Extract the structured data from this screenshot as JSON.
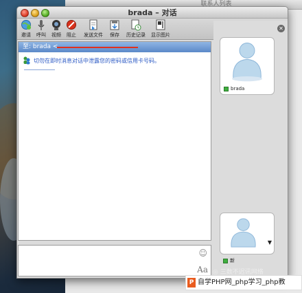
{
  "background_window": {
    "title": "联系人列表"
  },
  "window": {
    "title": "brada – 对话"
  },
  "toolbar": {
    "items": [
      {
        "label": "邀请",
        "icon": "invite-globe-icon"
      },
      {
        "label": "呼叫",
        "icon": "microphone-icon"
      },
      {
        "label": "视频",
        "icon": "webcam-icon"
      },
      {
        "label": "阻止",
        "icon": "block-icon"
      },
      {
        "label": "发送文件",
        "icon": "send-file-icon"
      },
      {
        "label": "保存",
        "icon": "save-icon"
      },
      {
        "label": "历史记录",
        "icon": "history-icon"
      },
      {
        "label": "显示图片",
        "icon": "show-picture-icon"
      }
    ]
  },
  "chat": {
    "header": "至: brada <",
    "warning": "切勿在即时消息对话中泄露您的密码或信用卡号码。"
  },
  "side_panel": {
    "contact_name": "brada",
    "self_name": "新"
  },
  "watermark": {
    "badge": "P",
    "text": "自学PHP网_php学习_php教"
  },
  "faint_text": "◎ 三数不迟讯网络"
}
